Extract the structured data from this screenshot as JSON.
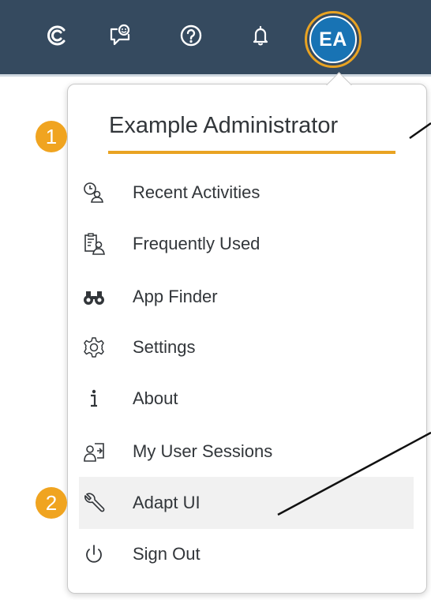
{
  "shell": {
    "background": "#354a5f",
    "icons": [
      "copilot-icon",
      "feedback-icon",
      "help-icon",
      "notifications-icon"
    ],
    "avatar_initials": "EA",
    "avatar_color": "#1873b4",
    "highlight_color": "#e9a322"
  },
  "user_menu": {
    "user_name": "Example Administrator",
    "items": [
      {
        "label": "Recent Activities",
        "icon": "recent-activities-icon"
      },
      {
        "label": "Frequently Used",
        "icon": "frequently-used-icon"
      },
      {
        "label": "App Finder",
        "icon": "binoculars-icon"
      },
      {
        "label": "Settings",
        "icon": "gear-icon"
      },
      {
        "label": "About",
        "icon": "info-icon"
      },
      {
        "label": "My User Sessions",
        "icon": "user-sessions-icon"
      },
      {
        "label": "Adapt UI",
        "icon": "wrench-icon"
      },
      {
        "label": "Sign Out",
        "icon": "power-icon"
      }
    ]
  },
  "annotations": {
    "badge_1": "1",
    "badge_2": "2",
    "badge_color": "#f0a420"
  }
}
